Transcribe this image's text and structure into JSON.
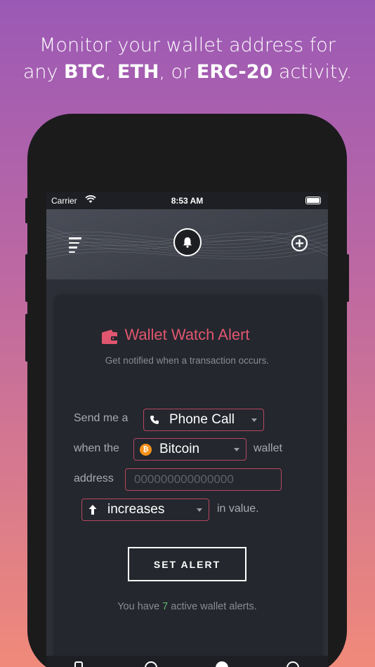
{
  "headline": {
    "line1": "Monitor your wallet address for",
    "line2_prefix": "any ",
    "btc": "BTC",
    "sep1": ", ",
    "eth": "ETH",
    "sep2": ", or ",
    "erc": "ERC-20",
    "line2_suffix": " activity."
  },
  "status_bar": {
    "carrier": "Carrier",
    "time": "8:53 AM"
  },
  "navbar": {
    "left_icon": "menu-icon",
    "center_icon": "bell-icon",
    "right_icon": "plus-circle-icon"
  },
  "card": {
    "icon": "wallet-icon",
    "title": "Wallet Watch Alert",
    "subtitle": "Get notified when a transaction occurs."
  },
  "form": {
    "send_label": "Send me a",
    "method_value": "Phone Call",
    "when_label": "when the",
    "coin_value": "Bitcoin",
    "wallet_label": "wallet",
    "address_label": "address",
    "address_placeholder": "000000000000000",
    "direction_value": "increases",
    "value_label": "in value."
  },
  "button": {
    "label": "SET ALERT"
  },
  "footer": {
    "prefix": "You have ",
    "count": "7",
    "suffix": " active wallet alerts."
  },
  "colors": {
    "accent": "#e0566f",
    "border": "#b5475f",
    "count": "#5fb86a",
    "btc": "#f7931a"
  }
}
